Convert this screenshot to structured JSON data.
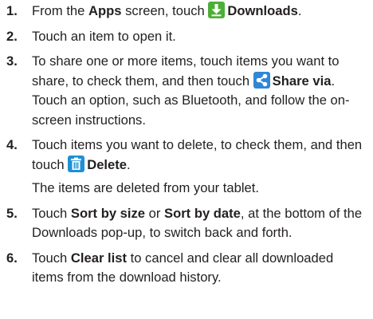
{
  "steps": [
    {
      "num": "1.",
      "t1": "From the ",
      "b1": "Apps",
      "t2": " screen, touch ",
      "icon": "download-icon",
      "b2": "Downloads",
      "t3": "."
    },
    {
      "num": "2.",
      "text": "Touch an item to open it."
    },
    {
      "num": "3.",
      "t1": "To share one or more items, touch items you want to share, to check them, and then touch ",
      "icon": "share-icon",
      "b1": "Share via",
      "t2": ". Touch an option, such as Bluetooth, and follow the on-screen instructions."
    },
    {
      "num": "4.",
      "t1": "Touch items you want to delete, to check them, and then touch ",
      "icon": "trash-icon",
      "b1": "Delete",
      "t2": ".",
      "note": "The items are deleted from your tablet."
    },
    {
      "num": "5.",
      "t1": "Touch ",
      "b1": "Sort by size",
      "t2": " or ",
      "b2": "Sort by date",
      "t3": ", at the bottom of the Downloads pop-up, to switch back and forth."
    },
    {
      "num": "6.",
      "t1": "Touch ",
      "b1": "Clear list",
      "t2": " to cancel and clear all downloaded items from the download history."
    }
  ],
  "colors": {
    "download_icon_bg": "#4caf36",
    "share_icon_bg": "#2f87d6",
    "trash_icon_bg": "#1f8fd6",
    "text": "#231f20"
  }
}
